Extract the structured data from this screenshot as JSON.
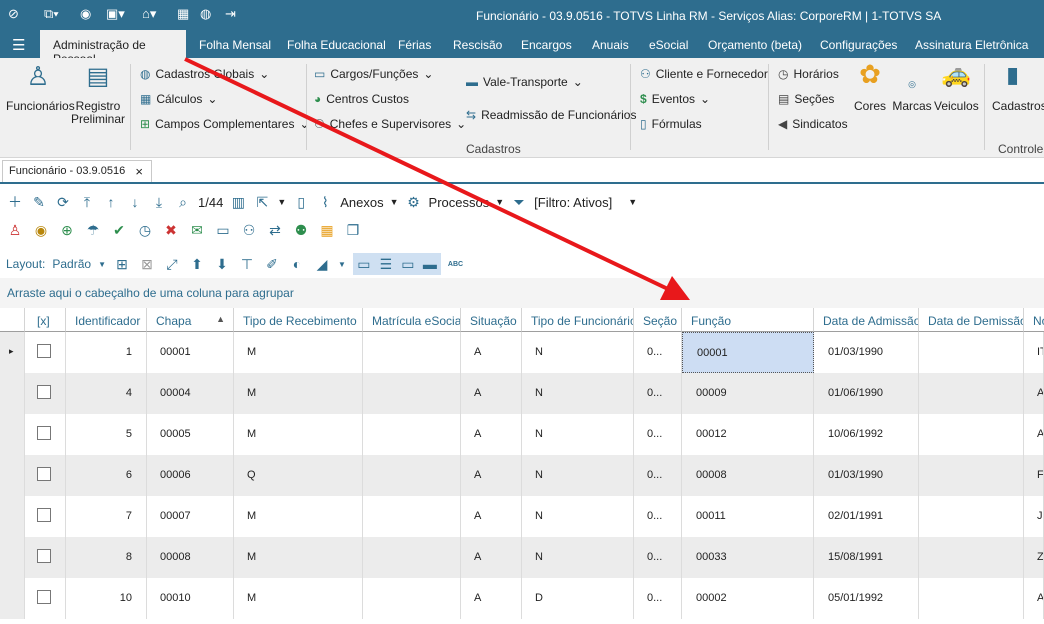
{
  "window": {
    "title": "Funcionário - 03.9.0516 - TOTVS Linha RM - Serviços  Alias: CorporeRM | 1-TOTVS SA"
  },
  "menu": [
    "Administração de Pessoal",
    "Folha Mensal",
    "Folha Educacional",
    "Férias",
    "Rescisão",
    "Encargos",
    "Anuais",
    "eSocial",
    "Orçamento (beta)",
    "Configurações",
    "Assinatura Eletrônica"
  ],
  "ribbon": {
    "funcionarios": "Funcionários",
    "registro_l1": "Registro",
    "registro_l2": "Preliminar",
    "cadastros_globais": "Cadastros Globais",
    "calculos": "Cálculos",
    "campos_complementares": "Campos Complementares",
    "cargos_funcoes": "Cargos/Funções",
    "centros_custos": "Centros Custos",
    "chefes": "Chefes e Supervisores",
    "vale_transporte": "Vale-Transporte",
    "readmissao": "Readmissão de Funcionários",
    "cliente_fornecedor": "Cliente e Fornecedor",
    "eventos": "Eventos",
    "formulas": "Fórmulas",
    "horarios": "Horários",
    "secoes": "Seções",
    "sindicatos": "Sindicatos",
    "cores": "Cores",
    "marcas": "Marcas",
    "veiculos": "Veiculos",
    "cadastros2": "Cadastros",
    "group_cadastros": "Cadastros",
    "group_controle": "Controle d"
  },
  "doctab": {
    "label": "Funcionário - 03.9.0516",
    "close": "×"
  },
  "toolbar": {
    "pager": "1/44",
    "anexos": "Anexos",
    "processos": "Processos",
    "filtro": "[Filtro: Ativos]"
  },
  "layout": {
    "label": "Layout:",
    "value": "Padrão"
  },
  "group_hint": "Arraste aqui o cabeçalho de uma coluna para agrupar",
  "columns": [
    "[x]",
    "Identificador",
    "Chapa",
    "Tipo de Recebimento",
    "Matrícula eSocial",
    "Situação",
    "Tipo de Funcionário",
    "Seção",
    "Função",
    "Data de Admissão",
    "Data de Demissão",
    "No"
  ],
  "rows": [
    {
      "id": "1",
      "chapa": "00001",
      "tipo": "M",
      "sit": "A",
      "tfunc": "N",
      "secao": "0...",
      "funcao": "00001",
      "adm": "01/03/1990",
      "nome": "IT"
    },
    {
      "id": "4",
      "chapa": "00004",
      "tipo": "M",
      "sit": "A",
      "tfunc": "N",
      "secao": "0...",
      "funcao": "00009",
      "adm": "01/06/1990",
      "nome": "A"
    },
    {
      "id": "5",
      "chapa": "00005",
      "tipo": "M",
      "sit": "A",
      "tfunc": "N",
      "secao": "0...",
      "funcao": "00012",
      "adm": "10/06/1992",
      "nome": "A"
    },
    {
      "id": "6",
      "chapa": "00006",
      "tipo": "Q",
      "sit": "A",
      "tfunc": "N",
      "secao": "0...",
      "funcao": "00008",
      "adm": "01/03/1990",
      "nome": "FI"
    },
    {
      "id": "7",
      "chapa": "00007",
      "tipo": "M",
      "sit": "A",
      "tfunc": "N",
      "secao": "0...",
      "funcao": "00011",
      "adm": "02/01/1991",
      "nome": "JC"
    },
    {
      "id": "8",
      "chapa": "00008",
      "tipo": "M",
      "sit": "A",
      "tfunc": "N",
      "secao": "0...",
      "funcao": "00033",
      "adm": "15/08/1991",
      "nome": "Z"
    },
    {
      "id": "10",
      "chapa": "00010",
      "tipo": "M",
      "sit": "A",
      "tfunc": "D",
      "secao": "0...",
      "funcao": "00002",
      "adm": "05/01/1992",
      "nome": "A"
    }
  ],
  "colors": {
    "brand": "#2e6d8e",
    "arrow": "#e8181b",
    "selected": "#cdddf3"
  }
}
